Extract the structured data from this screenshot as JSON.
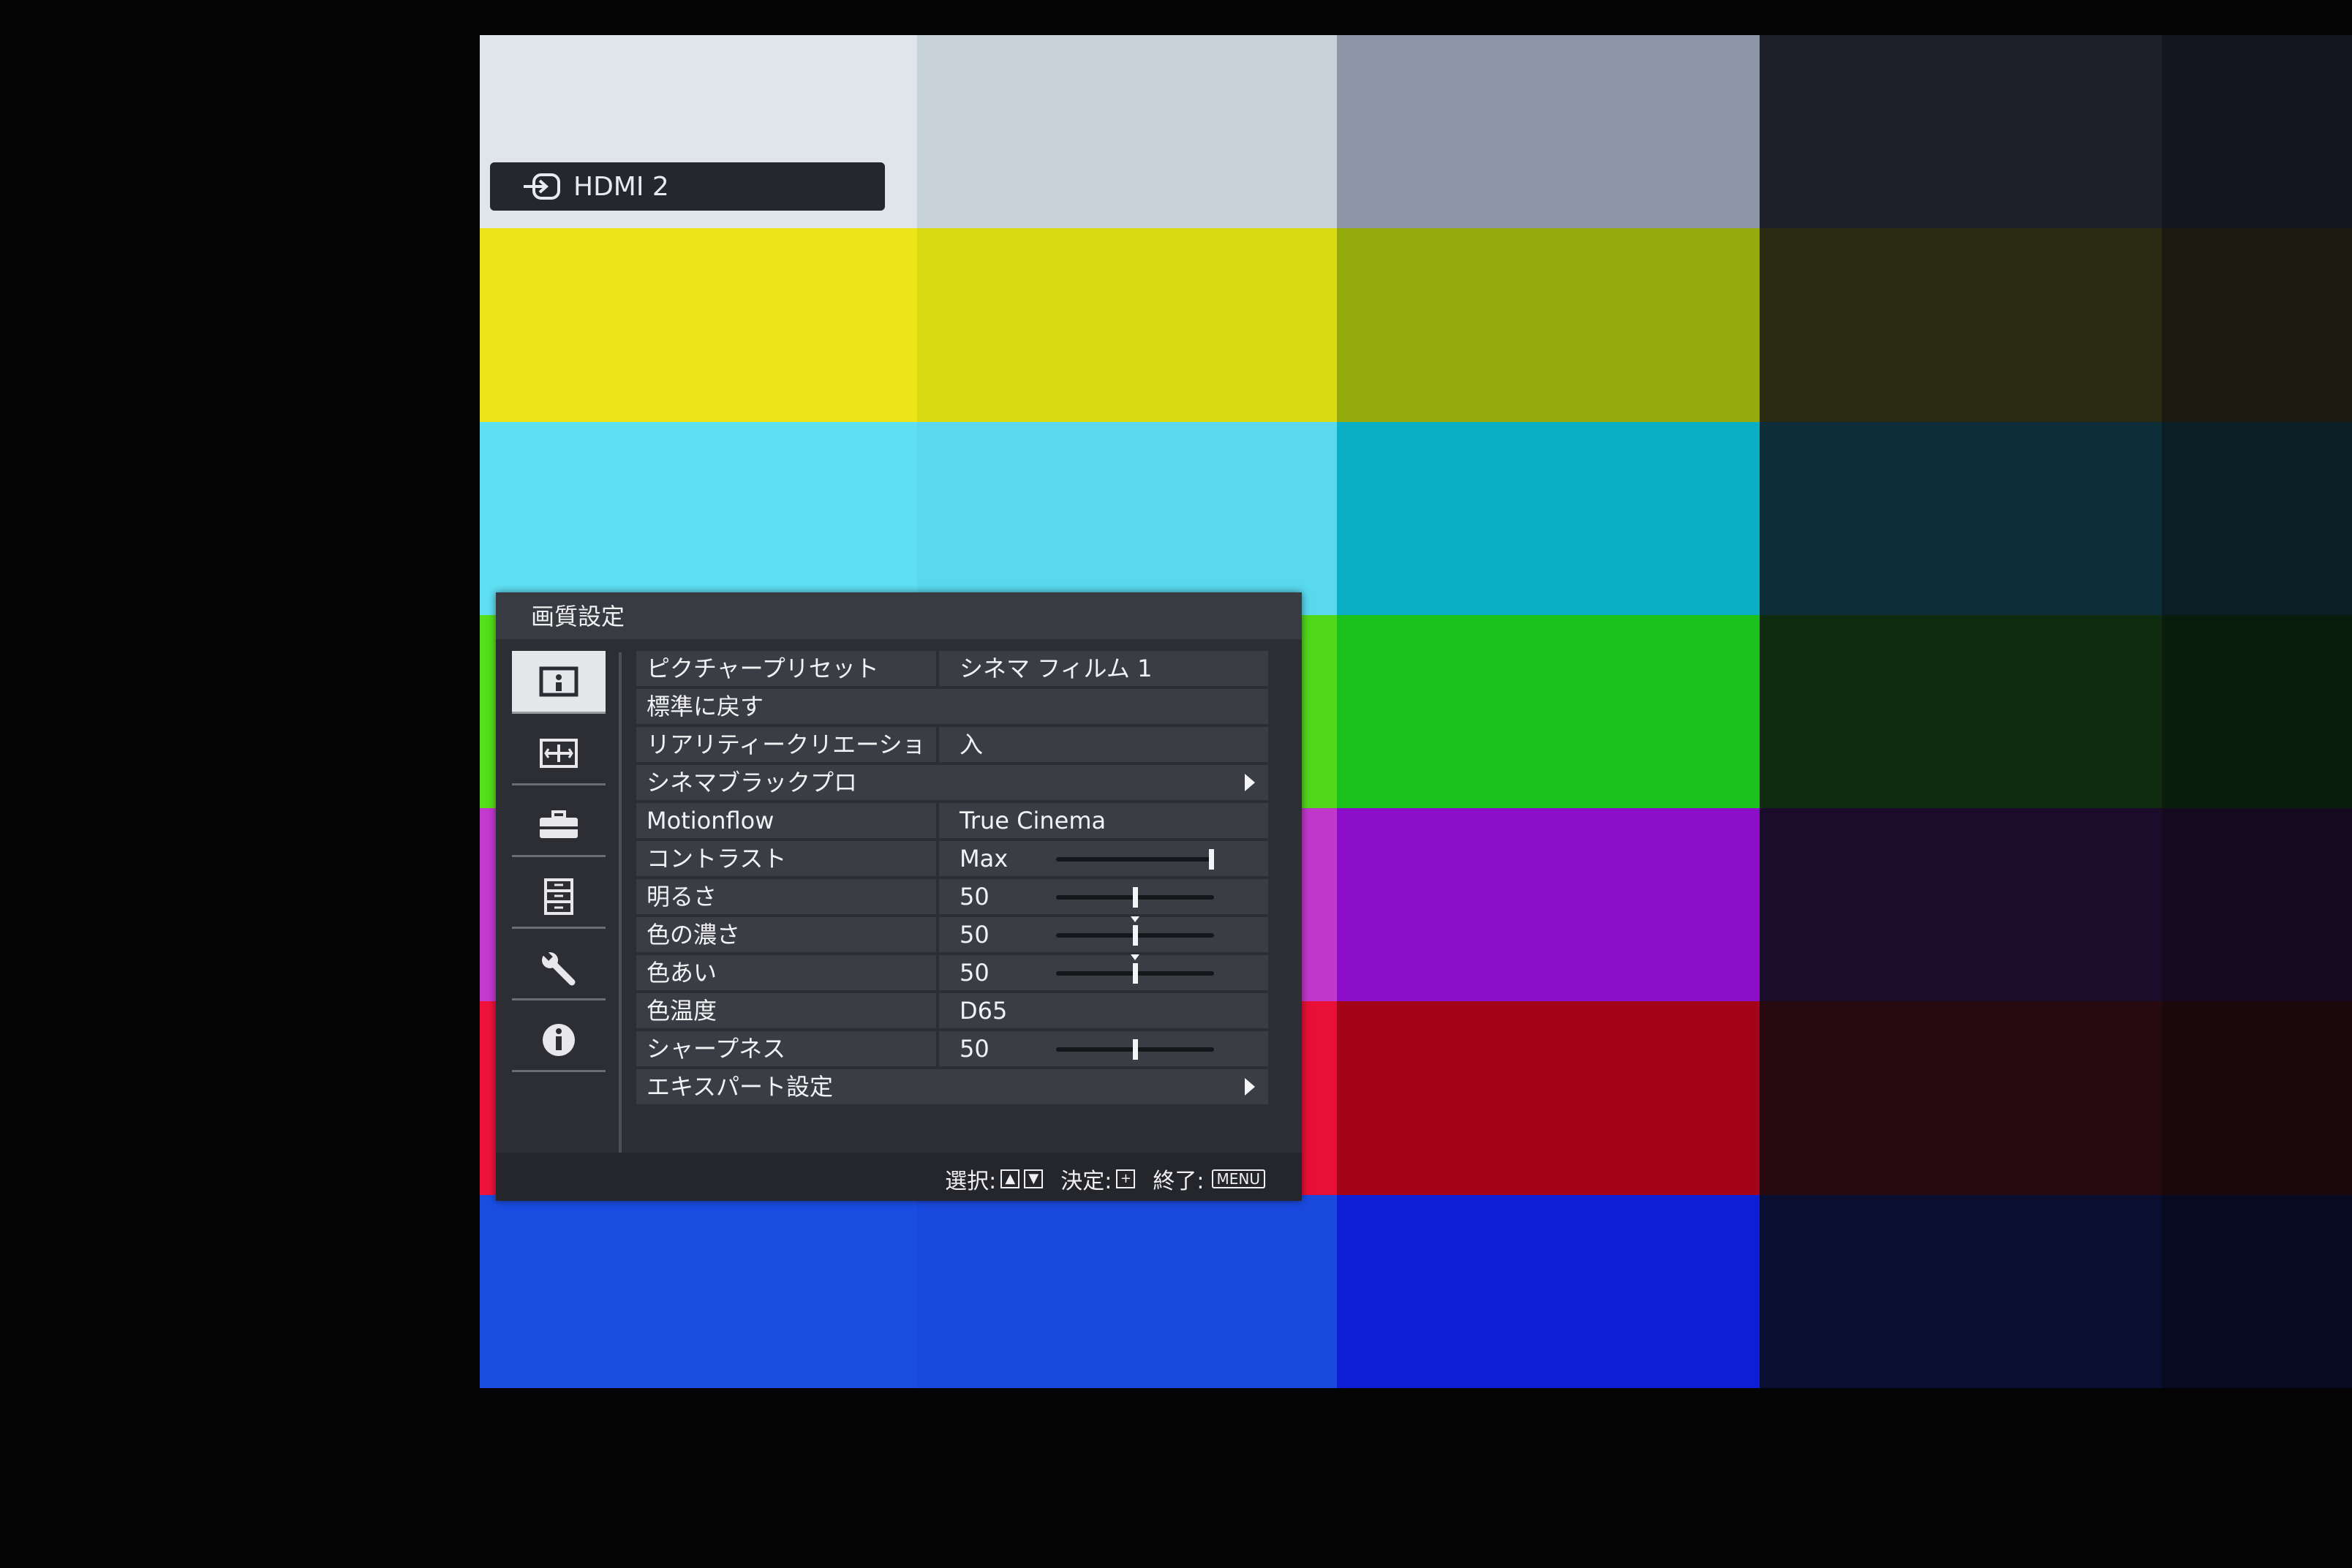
{
  "input": {
    "label": "HDMI 2",
    "icon": "input-source-icon"
  },
  "test_pattern": {
    "colors": [
      [
        "#dfe5ea",
        "#c7d1d8",
        "#8d95a7",
        "#1d1f2a",
        "#141520"
      ],
      [
        "#ede51a",
        "#dada12",
        "#93ac0c",
        "#292c10",
        "#1a1b0e"
      ],
      [
        "#5fdff2",
        "#5ad9ee",
        "#0aafc5",
        "#0d2e38",
        "#0a1e26"
      ],
      [
        "#54e01a",
        "#51d81a",
        "#1cc21c",
        "#0f2c10",
        "#0a1c0c"
      ],
      [
        "#c43ad0",
        "#c038cc",
        "#8c0ec8",
        "#1c0c2c",
        "#150a1e"
      ],
      [
        "#f0123a",
        "#e81036",
        "#a30418",
        "#260a10",
        "#1a080c"
      ],
      [
        "#1a4de2",
        "#1a49df",
        "#0e1ed4",
        "#0a0e30",
        "#080a22"
      ]
    ]
  },
  "menu": {
    "title": "画質設定",
    "categories": [
      {
        "icon": "picture-icon",
        "active": true
      },
      {
        "icon": "screen-icon",
        "active": false
      },
      {
        "icon": "toolbox-icon",
        "active": false
      },
      {
        "icon": "function-icon",
        "active": false
      },
      {
        "icon": "wrench-icon",
        "active": false
      },
      {
        "icon": "info-icon",
        "active": false
      }
    ],
    "items": [
      {
        "label": "ピクチャープリセット",
        "value": "シネマ フィルム 1"
      },
      {
        "label": "標準に戻す"
      },
      {
        "label": "リアリティークリエーション",
        "value": "入"
      },
      {
        "label": "シネマブラックプロ",
        "submenu": true
      },
      {
        "label": "Motionflow",
        "value": "True Cinema"
      },
      {
        "label": "コントラスト",
        "value": "Max",
        "level": 1.0
      },
      {
        "label": "明るさ",
        "value": "50",
        "level": 0.5
      },
      {
        "label": "色の濃さ",
        "value": "50",
        "level": 0.5,
        "center_mark": true
      },
      {
        "label": "色あい",
        "value": "50",
        "level": 0.5,
        "center_mark": true
      },
      {
        "label": "色温度",
        "value": "D65"
      },
      {
        "label": "シャープネス",
        "value": "50",
        "level": 0.5
      },
      {
        "label": "エキスパート設定",
        "submenu": true
      }
    ],
    "footer": {
      "select_label": "選択:",
      "enter_label": "決定:",
      "exit_label": "終了:",
      "menu_key": "MENU"
    }
  }
}
